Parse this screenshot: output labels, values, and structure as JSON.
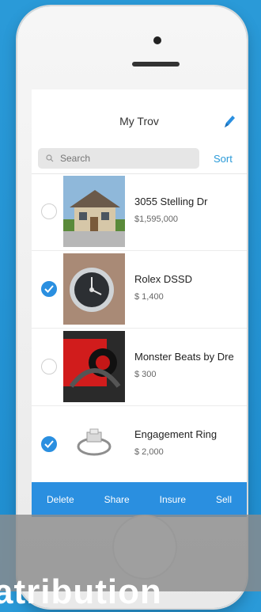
{
  "nav": {
    "title": "My Trov",
    "edit_icon": "pencil-icon"
  },
  "search": {
    "placeholder": "Search"
  },
  "sort_label": "Sort",
  "items": [
    {
      "title": "3055 Stelling Dr",
      "price": "$1,595,000",
      "checked": false
    },
    {
      "title": "Rolex DSSD",
      "price": "$ 1,400",
      "checked": true
    },
    {
      "title": "Monster Beats by Dre",
      "price": "$ 300",
      "checked": false
    },
    {
      "title": "Engagement Ring",
      "price": "$ 2,000",
      "checked": true
    }
  ],
  "toolbar": {
    "delete": "Delete",
    "share": "Share",
    "insure": "Insure",
    "sell": "Sell"
  },
  "overlay": {
    "text": "atribution"
  },
  "colors": {
    "accent": "#2a8fe0",
    "background": "#2a9ad8"
  }
}
